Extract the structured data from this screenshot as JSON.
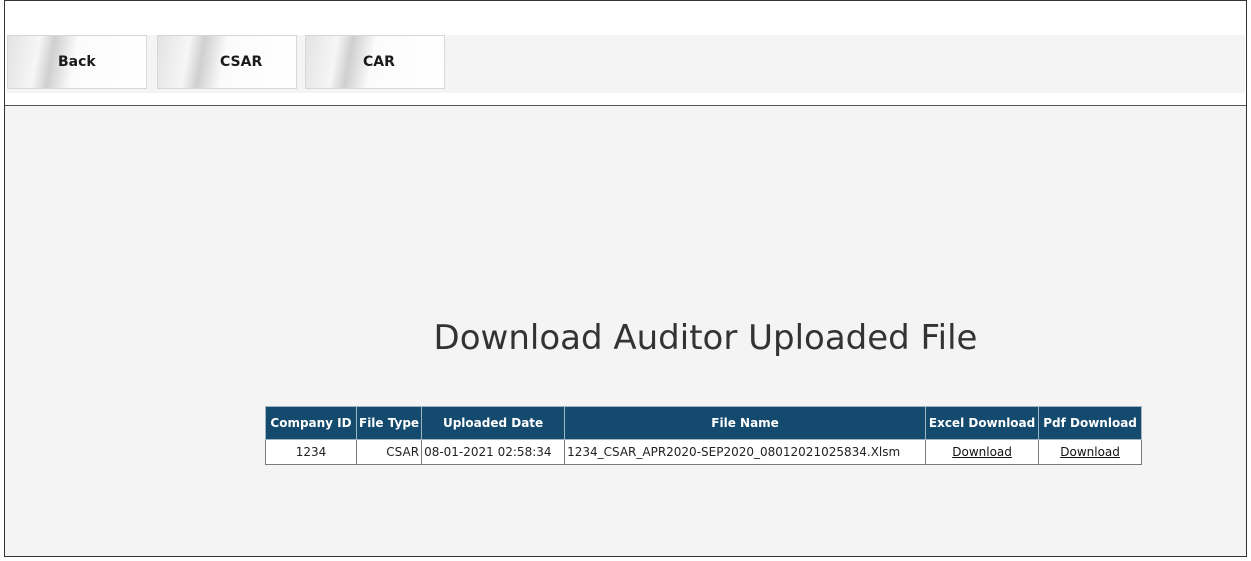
{
  "toolbar": {
    "buttons": [
      {
        "label": "Back"
      },
      {
        "label": "CSAR"
      },
      {
        "label": "CAR"
      }
    ]
  },
  "main": {
    "title": "Download Auditor Uploaded File",
    "table": {
      "headers": [
        "Company ID",
        "File Type",
        "Uploaded Date",
        "File Name",
        "Excel Download",
        "Pdf Download"
      ],
      "rows": [
        {
          "company_id": "1234",
          "file_type": "CSAR",
          "uploaded_date": "08-01-2021 02:58:34",
          "file_name": "1234_CSAR_APR2020-SEP2020_08012021025834.Xlsm",
          "excel_download": "Download",
          "pdf_download": "Download"
        }
      ]
    }
  },
  "colors": {
    "header_bg": "#144a6e",
    "content_bg": "#f4f4f4"
  }
}
